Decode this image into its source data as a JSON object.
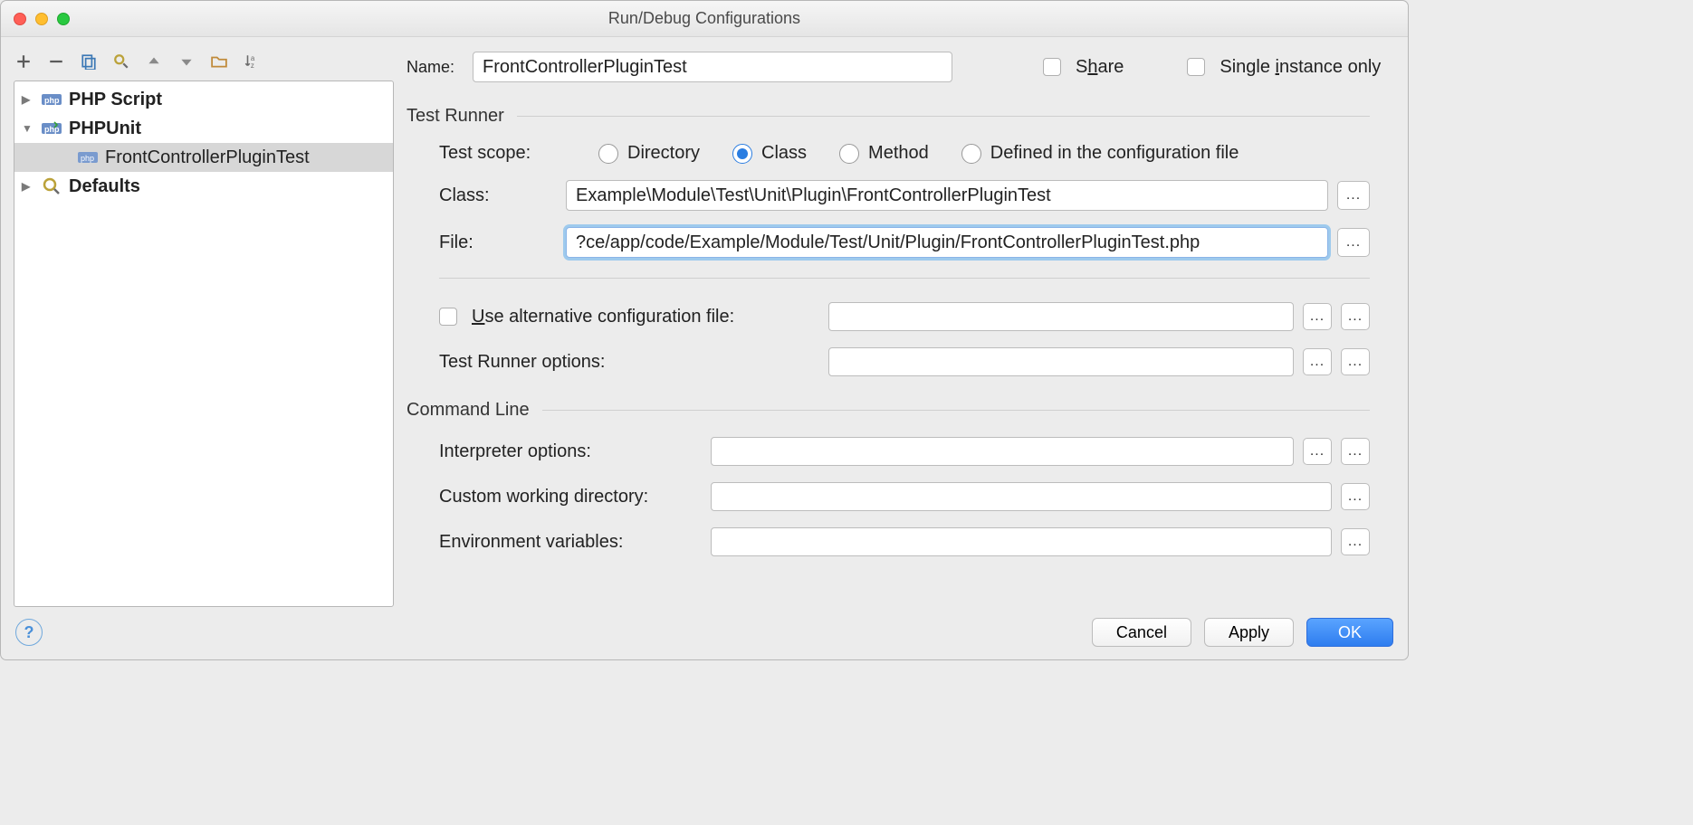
{
  "window_title": "Run/Debug Configurations",
  "toolbar": {
    "add": "+",
    "remove": "−"
  },
  "tree": {
    "items": [
      {
        "label": "PHP Script",
        "bold": true,
        "expanded_icon": "▶"
      },
      {
        "label": "PHPUnit",
        "bold": true,
        "expanded_icon": "▼"
      },
      {
        "label": "FrontControllerPluginTest",
        "selected": true
      },
      {
        "label": "Defaults",
        "bold": true,
        "expanded_icon": "▶"
      }
    ]
  },
  "name_label": "Name:",
  "name_value": "FrontControllerPluginTest",
  "share_label_pre": "S",
  "share_label_underlined": "h",
  "share_label_post": "are",
  "single_instance_pre": "Single ",
  "single_instance_underlined": "i",
  "single_instance_post": "nstance only",
  "test_runner": {
    "title": "Test Runner",
    "scope_label": "Test scope:",
    "scopes": {
      "directory": "Directory",
      "class": "Class",
      "method": "Method",
      "defined": "Defined in the configuration file"
    },
    "class_label": "Class:",
    "class_value": "Example\\Module\\Test\\Unit\\Plugin\\FrontControllerPluginTest",
    "file_label": "File:",
    "file_value": "?ce/app/code/Example/Module/Test/Unit/Plugin/FrontControllerPluginTest.php",
    "alt_cfg_pre": "U",
    "alt_cfg_label": "se alternative configuration file:",
    "alt_cfg_value": "",
    "runner_options_label": "Test Runner options:",
    "runner_options_value": ""
  },
  "command_line": {
    "title": "Command Line",
    "interp_label": "Interpreter options:",
    "interp_value": "",
    "cwd_label": "Custom working directory:",
    "cwd_value": "",
    "env_label": "Environment variables:",
    "env_value": ""
  },
  "buttons": {
    "cancel": "Cancel",
    "apply": "Apply",
    "ok": "OK"
  },
  "help": "?"
}
